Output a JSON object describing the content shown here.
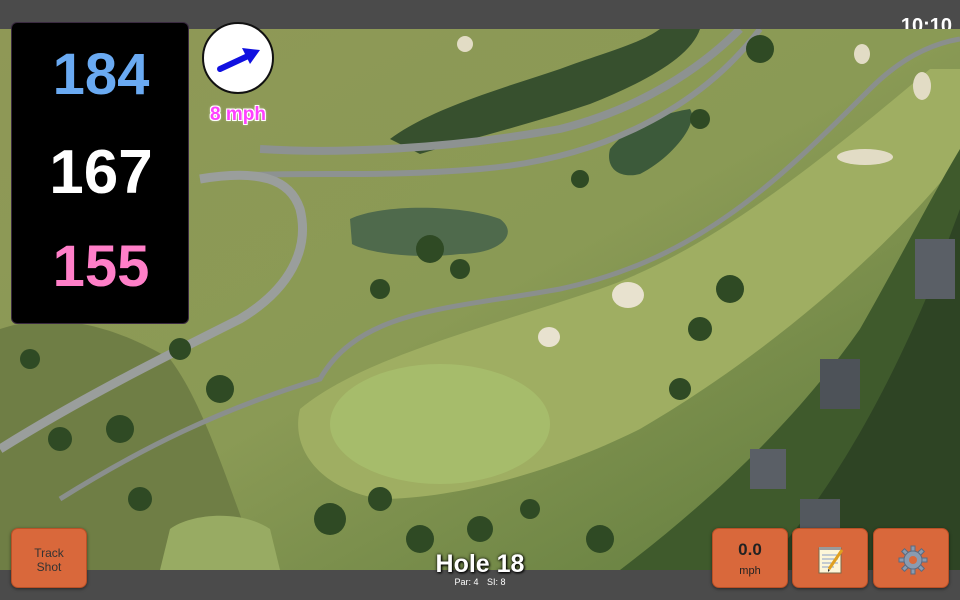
{
  "status_bar": {
    "time": "10:10"
  },
  "yardages": {
    "back": "184",
    "middle": "167",
    "front": "155",
    "colors": {
      "back": "#6aaaf2",
      "middle": "#ffffff",
      "front": "#ff7fc8"
    }
  },
  "wind": {
    "speed_label": "8 mph",
    "icon": "wind-direction-arrow-icon",
    "arrow_color": "#1010e0"
  },
  "buttons": {
    "track_shot": {
      "line1": "Track",
      "line2": "Shot"
    },
    "speed": {
      "value": "0.0",
      "unit": "mph"
    },
    "notes": {
      "icon": "notepad-icon"
    },
    "settings": {
      "icon": "gear-icon"
    }
  },
  "hole": {
    "title": "Hole 18",
    "par": "Par: 4",
    "si": "SI: 8"
  },
  "colors": {
    "button_bg": "#d9683b",
    "bar_bg": "#4b4b4b"
  }
}
